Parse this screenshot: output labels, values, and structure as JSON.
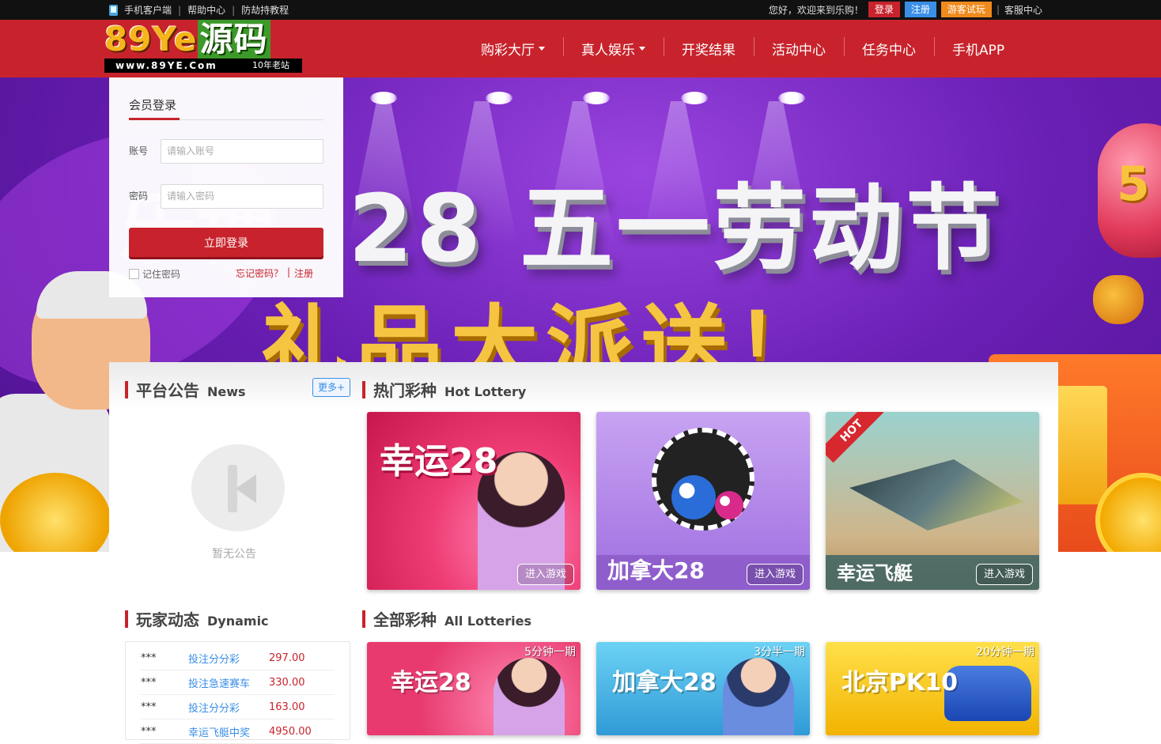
{
  "topbar": {
    "links": [
      "手机客户端",
      "帮助中心",
      "防劫持教程"
    ],
    "welcome": "您好，欢迎来到乐购！",
    "login_btn": "登录",
    "register_btn": "注册",
    "guest_btn": "游客试玩",
    "service": "客服中心"
  },
  "header": {
    "logo_main": "89Ye",
    "logo_cn": "源码",
    "logo_url": "www.89YE.Com",
    "logo_tag": "10年老站",
    "nav": [
      {
        "label": "购彩大厅",
        "dropdown": true
      },
      {
        "label": "真人娱乐",
        "dropdown": true
      },
      {
        "label": "开奖结果",
        "dropdown": false
      },
      {
        "label": "活动中心",
        "dropdown": false
      },
      {
        "label": "任务中心",
        "dropdown": false
      },
      {
        "label": "手机APP",
        "dropdown": false
      }
    ]
  },
  "banner": {
    "headline": "28 五一劳动节",
    "ghost": "乐博",
    "subline": "礼品大派送！",
    "balloon_number": "5",
    "slide_count": 4,
    "active_slide": 1
  },
  "login": {
    "tab": "会员登录",
    "account_label": "账号",
    "account_placeholder": "请输入账号",
    "password_label": "密码",
    "password_placeholder": "请输入密码",
    "submit": "立即登录",
    "remember": "记住密码",
    "forgot": "忘记密码？",
    "separator": "|",
    "register": "注册"
  },
  "news": {
    "title_cn": "平台公告",
    "title_en": "News",
    "more": "更多+",
    "empty_text": "暂无公告"
  },
  "hot_lottery": {
    "title_cn": "热门彩种",
    "title_en": "Hot Lottery",
    "cards": [
      {
        "name": "幸运28",
        "enter": "进入游戏"
      },
      {
        "name": "加拿大28",
        "enter": "进入游戏"
      },
      {
        "name": "幸运飞艇",
        "enter": "进入游戏",
        "badge": "HOT"
      }
    ]
  },
  "dynamic": {
    "title_cn": "玩家动态",
    "title_en": "Dynamic",
    "rows": [
      {
        "user": "***",
        "game": "投注分分彩",
        "amount": "297.00"
      },
      {
        "user": "***",
        "game": "投注急速赛车",
        "amount": "330.00"
      },
      {
        "user": "***",
        "game": "投注分分彩",
        "amount": "163.00"
      },
      {
        "user": "***",
        "game": "幸运飞艇中奖",
        "amount": "4950.00"
      }
    ]
  },
  "all_lotteries": {
    "title_cn": "全部彩种",
    "title_en": "All Lotteries",
    "items": [
      {
        "name": "幸运28",
        "period": "5分钟一期"
      },
      {
        "name": "加拿大28",
        "period": "3分半一期"
      },
      {
        "name": "北京PK10",
        "period": "20分钟一期"
      }
    ]
  }
}
